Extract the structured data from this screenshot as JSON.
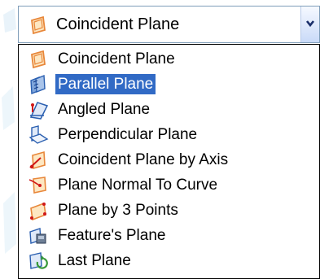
{
  "combo": {
    "selected_label": "Coincident Plane",
    "icon": "coincident-plane-icon"
  },
  "options": [
    {
      "label": "Coincident Plane",
      "icon": "coincident-plane-icon"
    },
    {
      "label": "Parallel Plane",
      "icon": "parallel-plane-icon",
      "highlighted": true
    },
    {
      "label": "Angled Plane",
      "icon": "angled-plane-icon"
    },
    {
      "label": "Perpendicular Plane",
      "icon": "perpendicular-plane-icon"
    },
    {
      "label": "Coincident Plane by Axis",
      "icon": "coincident-plane-by-axis-icon"
    },
    {
      "label": "Plane Normal To Curve",
      "icon": "plane-normal-to-curve-icon"
    },
    {
      "label": "Plane by 3 Points",
      "icon": "plane-by-3-points-icon"
    },
    {
      "label": "Feature's Plane",
      "icon": "features-plane-icon"
    },
    {
      "label": "Last Plane",
      "icon": "last-plane-icon"
    }
  ],
  "colors": {
    "highlight": "#316ac5",
    "icon_orange": "#e8873a",
    "icon_red": "#d01818",
    "icon_blue": "#2a5fb0",
    "icon_green": "#3a9a3a"
  }
}
